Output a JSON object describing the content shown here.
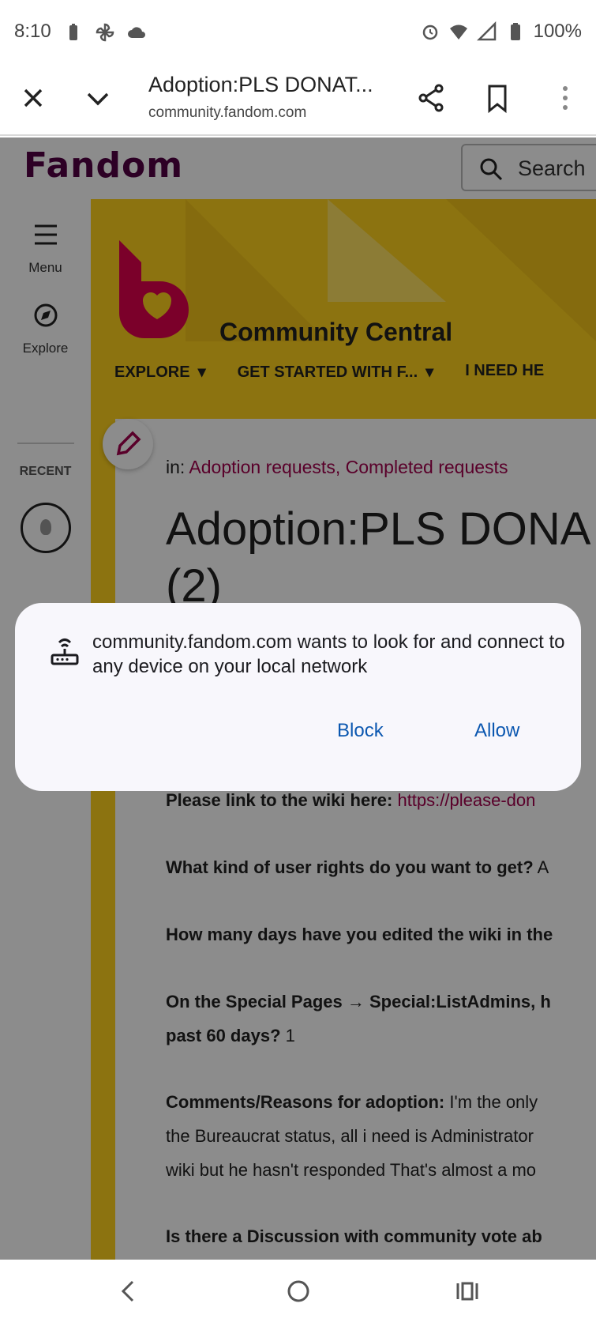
{
  "status_bar": {
    "time": "8:10",
    "battery": "100%",
    "left_icons": [
      "battery-saver-icon",
      "pinwheel-icon",
      "cloud-icon"
    ],
    "right_icons": [
      "alarm-icon",
      "wifi-icon",
      "signal-icon",
      "battery-icon"
    ]
  },
  "browser_tab": {
    "title": "Adoption:PLS DONAT...",
    "url": "community.fandom.com"
  },
  "fandom": {
    "logo_text": "Fandom",
    "search_label": "Search",
    "rail": {
      "menu": "Menu",
      "explore": "Explore",
      "recent": "RECENT"
    },
    "community_name": "Community Central",
    "nav_items": [
      "EXPLORE",
      "GET STARTED WITH F...",
      "I NEED HE"
    ]
  },
  "article": {
    "categories_prefix": "in: ",
    "categories": [
      "Adoption requests",
      "Completed requests"
    ],
    "title_line1": "Adoption:PLS DONA",
    "title_line2": "(2)",
    "qa": [
      {
        "q": "Please link to the wiki here:",
        "a": "https://please-don"
      },
      {
        "q": "What kind of user rights do you want to get?",
        "a": "A"
      },
      {
        "q": "How many days have you edited the wiki in the",
        "a": ""
      },
      {
        "q": "On the Special Pages → Special:ListAdmins, h",
        "a": ""
      },
      {
        "q": "past 60 days?",
        "a": "1"
      },
      {
        "q": "Comments/Reasons for adoption:",
        "a": "I'm the only"
      },
      {
        "q": "",
        "a": "the Bureaucrat status, all i need is Administrator"
      },
      {
        "q": "",
        "a": "wiki but he hasn't responded That's almost a mo"
      },
      {
        "q": "Is there a Discussion with community vote ab",
        "a": ""
      }
    ]
  },
  "dialog": {
    "message": "community.fandom.com wants to look for and connect to any device on your local network",
    "block_label": "Block",
    "allow_label": "Allow"
  },
  "colors": {
    "fandom_yellow": "#ffd21e",
    "fandom_pink": "#fa005a",
    "link_color": "#a3004d",
    "dialog_button": "#0b57b0"
  }
}
